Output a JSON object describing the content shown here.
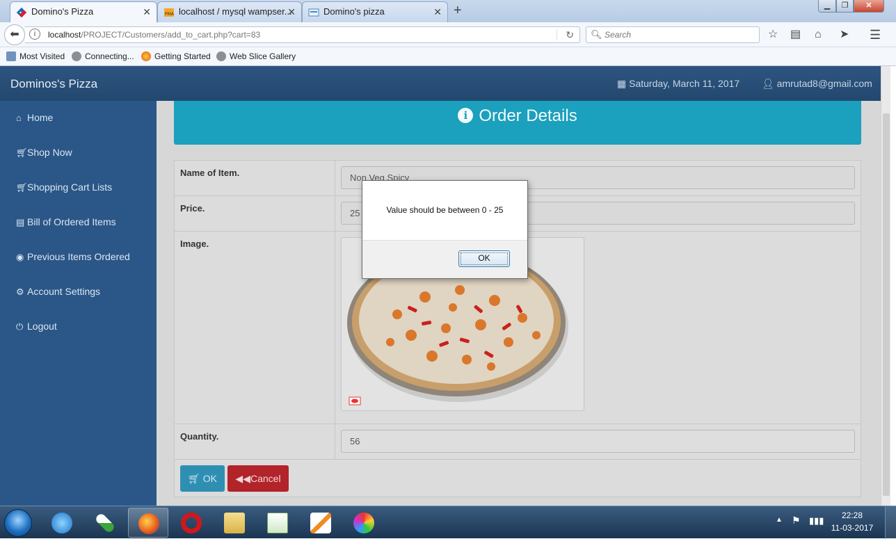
{
  "browser": {
    "tabs": [
      {
        "title": "Domino's Pizza",
        "active": true
      },
      {
        "title": "localhost / mysql wampser...",
        "active": false
      },
      {
        "title": "Domino's pizza",
        "active": false
      }
    ],
    "url": {
      "host": "localhost",
      "path": "/PROJECT/Customers/add_to_cart.php?cart=83"
    },
    "search_placeholder": "Search",
    "bookmarks": [
      "Most Visited",
      "Connecting...",
      "Getting Started",
      "Web Slice Gallery"
    ]
  },
  "app": {
    "brand": "Dominos's Pizza",
    "date": "Saturday, March 11, 2017",
    "user": "amrutad8@gmail.com"
  },
  "sidebar": {
    "items": [
      {
        "label": "Home",
        "icon": "home-icon"
      },
      {
        "label": "Shop Now",
        "icon": "cart-icon"
      },
      {
        "label": "Shopping Cart Lists",
        "icon": "cart-icon"
      },
      {
        "label": "Bill of Ordered Items",
        "icon": "list-icon"
      },
      {
        "label": "Previous Items Ordered",
        "icon": "eye-icon"
      },
      {
        "label": "Account Settings",
        "icon": "gear-icon"
      },
      {
        "label": "Logout",
        "icon": "power-icon"
      }
    ]
  },
  "order": {
    "title": "Order Details",
    "name_label": "Name of Item.",
    "name_value": "Non Veg Spicy",
    "price_label": "Price.",
    "price_value": "25",
    "image_label": "Image.",
    "quantity_label": "Quantity.",
    "quantity_value": "56",
    "ok_label": "OK",
    "cancel_label": "Cancel"
  },
  "dialog": {
    "message": "Value should be between 0 - 25",
    "ok_label": "OK"
  },
  "taskbar": {
    "time": "22:28",
    "date": "11-03-2017"
  },
  "colors": {
    "header": "#23486f",
    "sidebar": "#2a5787",
    "banner": "#1ba0bd",
    "ok_button": "#2f8fb3",
    "cancel_button": "#b3232a"
  }
}
